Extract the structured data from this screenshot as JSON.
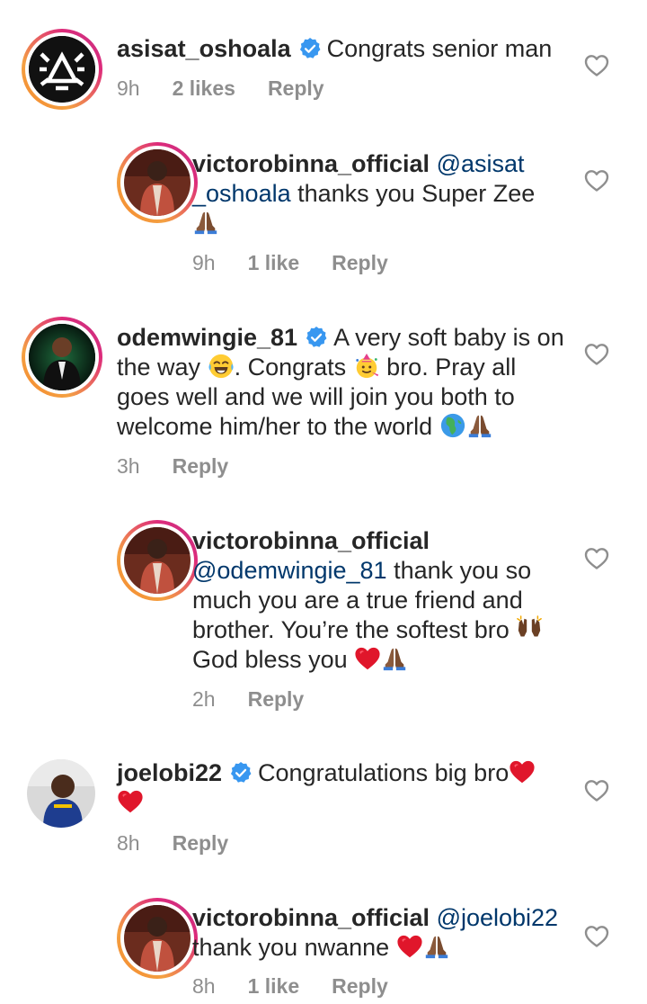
{
  "comments": [
    {
      "username": "asisat_oshoala",
      "text": "Congrats senior man",
      "time": "9h",
      "likes": "2 likes",
      "reply": "Reply"
    },
    {
      "username": "victorobinna_official",
      "mention": "@asisat _oshoala",
      "text": "thanks you Super Zee",
      "time": "9h",
      "likes": "1 like",
      "reply": "Reply"
    },
    {
      "username": "odemwingie_81",
      "text_a": "A very soft baby is on the way",
      "text_b": ". Congrats",
      "text_c": "bro. Pray all goes well and we will join you both to welcome him/her to the world",
      "time": "3h",
      "reply": "Reply"
    },
    {
      "username": "victorobinna_official",
      "mention": "@odemwingie_81",
      "text_a": "thank you so much you are a true friend and brother. You’re the softest bro",
      "text_b": "God bless you",
      "time": "2h",
      "reply": "Reply"
    },
    {
      "username": "joelobi22",
      "text": "Congratulations big bro",
      "time": "8h",
      "reply": "Reply"
    },
    {
      "username": "victorobinna_official",
      "mention": "@joelobi22",
      "text": "thank you nwanne",
      "time": "8h",
      "likes": "1 like",
      "reply": "Reply"
    }
  ],
  "icons": {
    "verified": "verified-badge-icon",
    "like": "heart-outline-icon",
    "praying_hands": "praying-hands-emoji",
    "joy": "tears-of-joy-emoji",
    "party": "party-face-emoji",
    "globe": "globe-africa-emoji",
    "raised_hands": "raised-hands-emoji",
    "red_heart": "red-heart-emoji"
  },
  "colors": {
    "text": "#262626",
    "meta": "#8e8e8e",
    "mention": "#00376b",
    "verified": "#3897f0",
    "heart_emoji": "#e0162b"
  }
}
